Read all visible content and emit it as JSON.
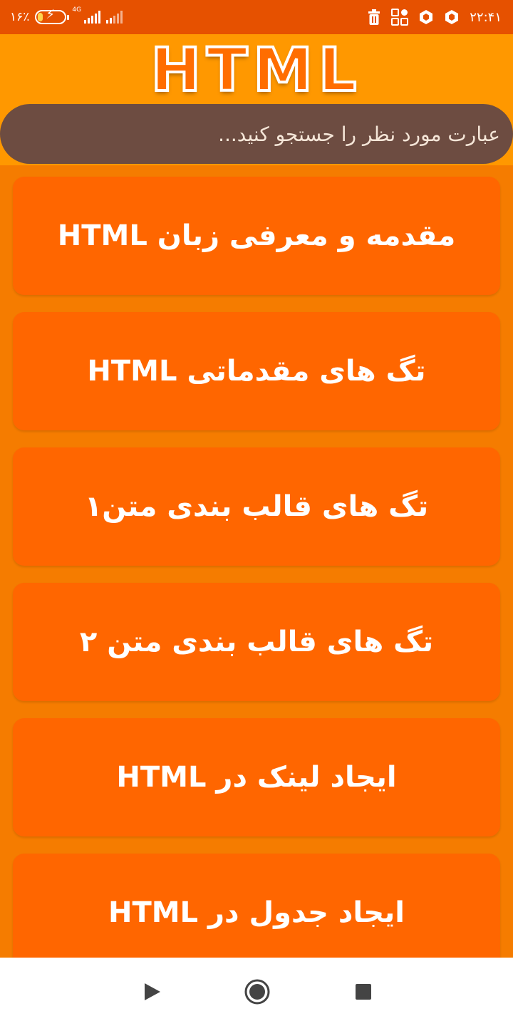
{
  "status_bar": {
    "battery_text": "۱۶٪",
    "battery_level": 0.16,
    "network_type": "4G",
    "time": "۲۲:۴۱",
    "icons": [
      "battery-charging-icon",
      "signal-icon",
      "signal-weak-icon",
      "trash-icon",
      "apps-icon",
      "hex-app-icon",
      "hex-app-icon-2"
    ]
  },
  "header": {
    "logo_text": "HTML",
    "search_placeholder": "عبارت مورد نظر را جستجو کنید..."
  },
  "lessons": [
    "مقدمه و معرفی زبان HTML",
    "تگ های مقدماتی HTML",
    "تگ های قالب بندی متن۱",
    "تگ های قالب بندی متن ۲",
    "ایجاد لینک در HTML",
    "ایجاد جدول در HTML"
  ],
  "nav_bar": {
    "icons": [
      "back-icon",
      "home-icon",
      "recents-icon"
    ]
  },
  "colors": {
    "status_bar": "#e65100",
    "header": "#ff9800",
    "search_bar": "#6d4c41",
    "list_background": "#f57c00",
    "card": "#ff6600",
    "nav_bar": "#ffffff"
  }
}
